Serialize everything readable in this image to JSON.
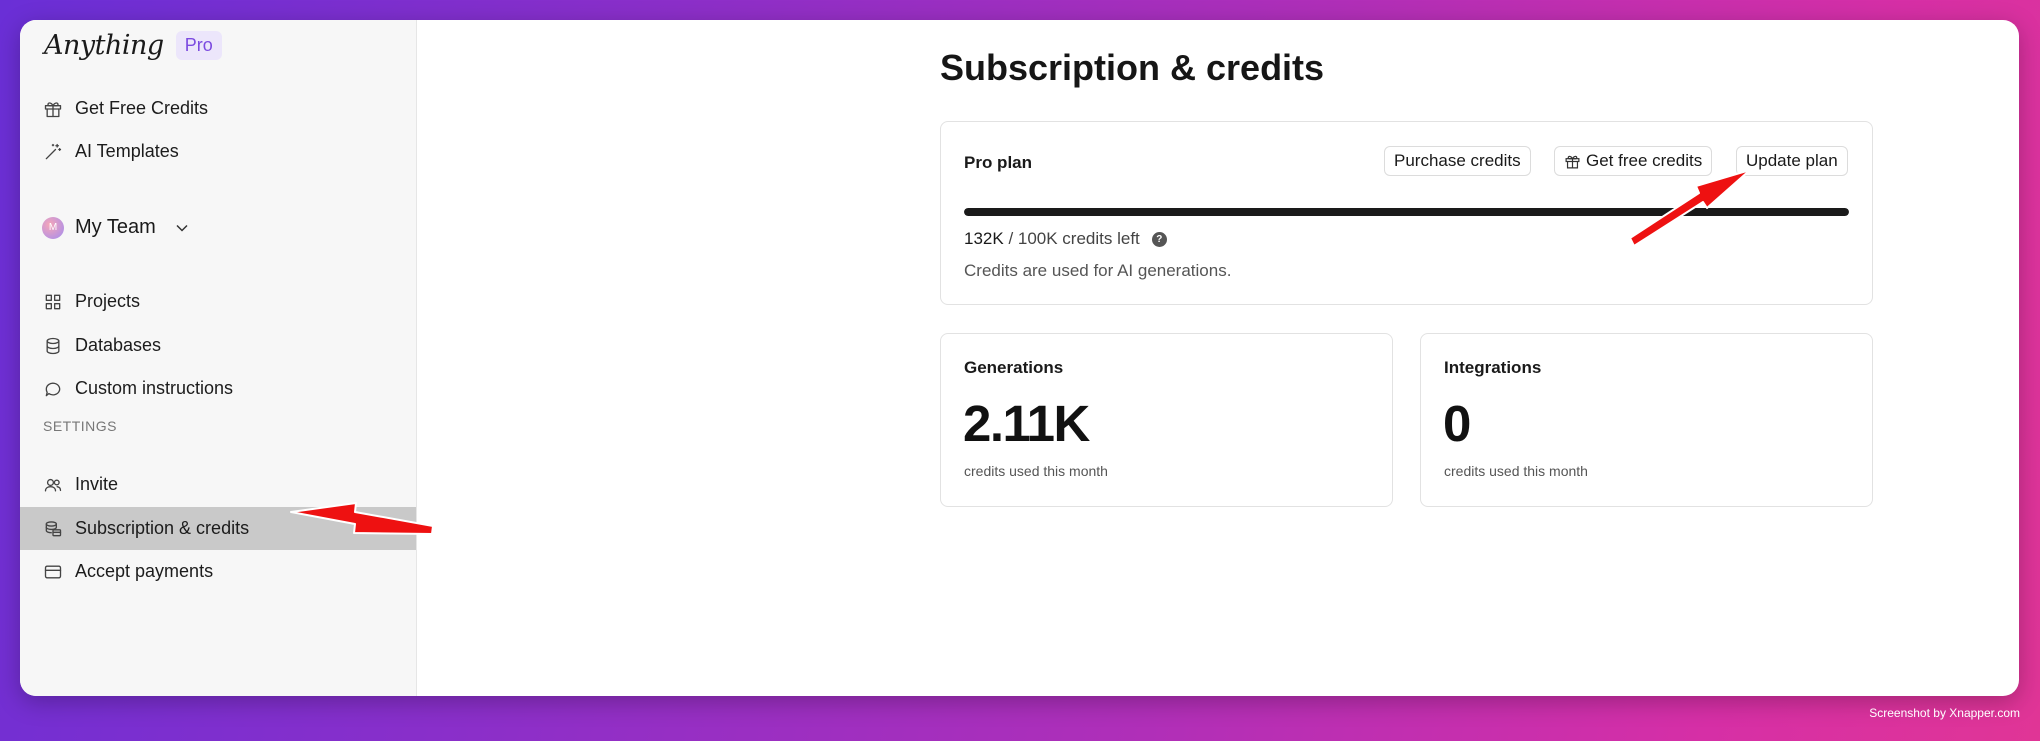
{
  "brand": {
    "logo": "Anything",
    "badge": "Pro"
  },
  "sidebar": {
    "top_items": [
      {
        "label": "Get Free Credits",
        "icon": "gift-icon"
      },
      {
        "label": "AI Templates",
        "icon": "magic-wand-icon"
      }
    ],
    "team": {
      "avatar_letter": "M",
      "name": "My Team"
    },
    "team_items": [
      {
        "label": "Projects",
        "icon": "grid-icon"
      },
      {
        "label": "Databases",
        "icon": "database-icon"
      },
      {
        "label": "Custom instructions",
        "icon": "chat-bubble-icon"
      }
    ],
    "settings_label": "SETTINGS",
    "settings_items": [
      {
        "label": "Invite",
        "icon": "users-icon"
      },
      {
        "label": "Subscription & credits",
        "icon": "coins-icon",
        "active": true
      },
      {
        "label": "Accept payments",
        "icon": "credit-card-icon"
      }
    ]
  },
  "main": {
    "title": "Subscription & credits",
    "plan": {
      "name": "Pro plan",
      "purchase_label": "Purchase credits",
      "free_label": "Get free credits",
      "update_label": "Update plan",
      "credits_left": "132K",
      "credits_total": "/ 100K credits left",
      "progress_fraction": 1.0,
      "note": "Credits are used for AI generations."
    },
    "stats": [
      {
        "title": "Generations",
        "value": "2.11K",
        "sub": "credits used this month"
      },
      {
        "title": "Integrations",
        "value": "0",
        "sub": "credits used this month"
      }
    ]
  },
  "watermark": "Screenshot by Xnapper.com",
  "colors": {
    "accent": "#7c4be0",
    "annotation_arrow": "#ee1111",
    "active_item_bg": "#c9c9c9"
  }
}
